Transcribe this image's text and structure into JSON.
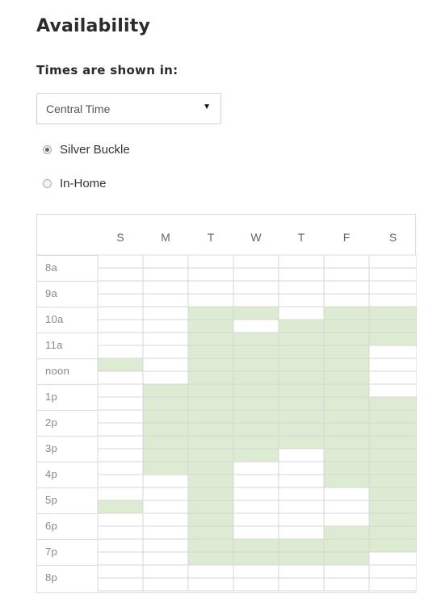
{
  "section_title": "Availability",
  "timezone": {
    "label": "Times are shown in:",
    "selected": "Central Time"
  },
  "location_options": [
    {
      "label": "Silver Buckle",
      "selected": true
    },
    {
      "label": "In-Home",
      "selected": false
    }
  ],
  "schedule": {
    "days": [
      "S",
      "M",
      "T",
      "W",
      "T",
      "F",
      "S"
    ],
    "hours": [
      "8a",
      "9a",
      "10a",
      "11a",
      "noon",
      "1p",
      "2p",
      "3p",
      "4p",
      "5p",
      "6p",
      "7p",
      "8p"
    ],
    "available_color": "#dcebd2",
    "available_half_hours": [
      [
        8,
        19
      ],
      [
        10,
        11,
        12,
        13,
        14,
        15,
        16
      ],
      [
        4,
        5,
        6,
        7,
        8,
        9,
        10,
        11,
        12,
        13,
        14,
        15,
        16,
        17,
        18,
        19,
        20,
        21,
        22,
        23
      ],
      [
        4,
        6,
        7,
        8,
        9,
        10,
        11,
        12,
        13,
        14,
        15,
        22,
        23
      ],
      [
        5,
        6,
        7,
        8,
        9,
        10,
        11,
        12,
        13,
        14,
        22,
        23
      ],
      [
        4,
        5,
        6,
        7,
        8,
        9,
        10,
        11,
        12,
        13,
        14,
        15,
        16,
        17,
        21,
        22,
        23
      ],
      [
        4,
        5,
        6,
        11,
        12,
        13,
        14,
        15,
        16,
        17,
        18,
        19,
        20,
        21,
        22
      ]
    ]
  }
}
